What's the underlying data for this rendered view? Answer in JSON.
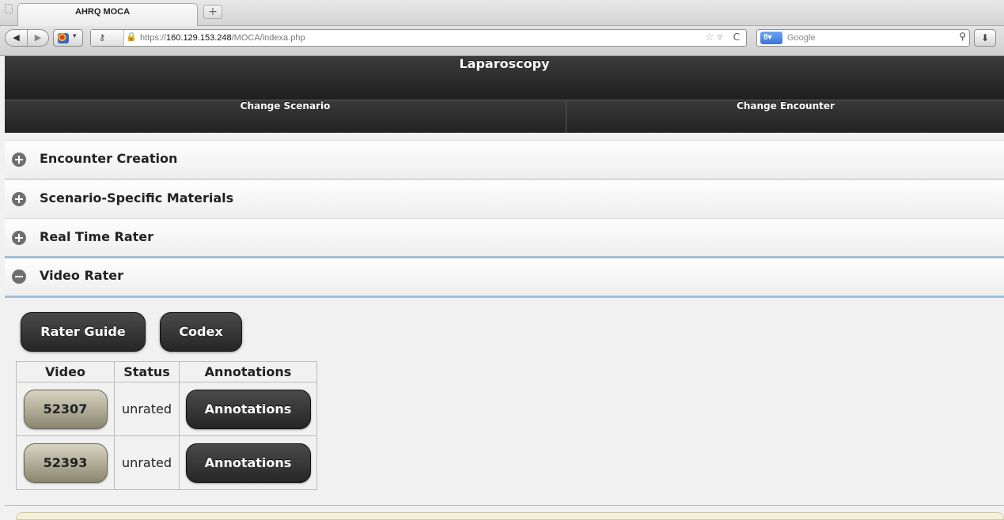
{
  "browser": {
    "tab_title": "AHRQ MOCA",
    "new_tab_symbol": "+",
    "url_host_prefix": "https://",
    "url_host": "160.129.153.248",
    "url_path": "/MOCA/indexa.php",
    "search_engine": "Google",
    "back_symbol": "◀",
    "forward_symbol": "▶"
  },
  "header": {
    "title": "Laparoscopy"
  },
  "nav": {
    "change_scenario": "Change Scenario",
    "change_encounter": "Change Encounter"
  },
  "sections": [
    {
      "label": "Encounter Creation",
      "state": "collapsed"
    },
    {
      "label": "Scenario-Specific Materials",
      "state": "collapsed"
    },
    {
      "label": "Real Time Rater",
      "state": "collapsed"
    },
    {
      "label": "Video Rater",
      "state": "expanded"
    }
  ],
  "video_rater": {
    "rater_guide_label": "Rater Guide",
    "codex_label": "Codex",
    "columns": [
      "Video",
      "Status",
      "Annotations"
    ],
    "rows": [
      {
        "video": "52307",
        "status": "unrated",
        "annotations": "Annotations"
      },
      {
        "video": "52393",
        "status": "unrated",
        "annotations": "Annotations"
      }
    ]
  },
  "colors": {
    "header_bg": "#2b2b2b",
    "active_section_border": "#a3bfd9",
    "video_button": "#b5b19b"
  }
}
